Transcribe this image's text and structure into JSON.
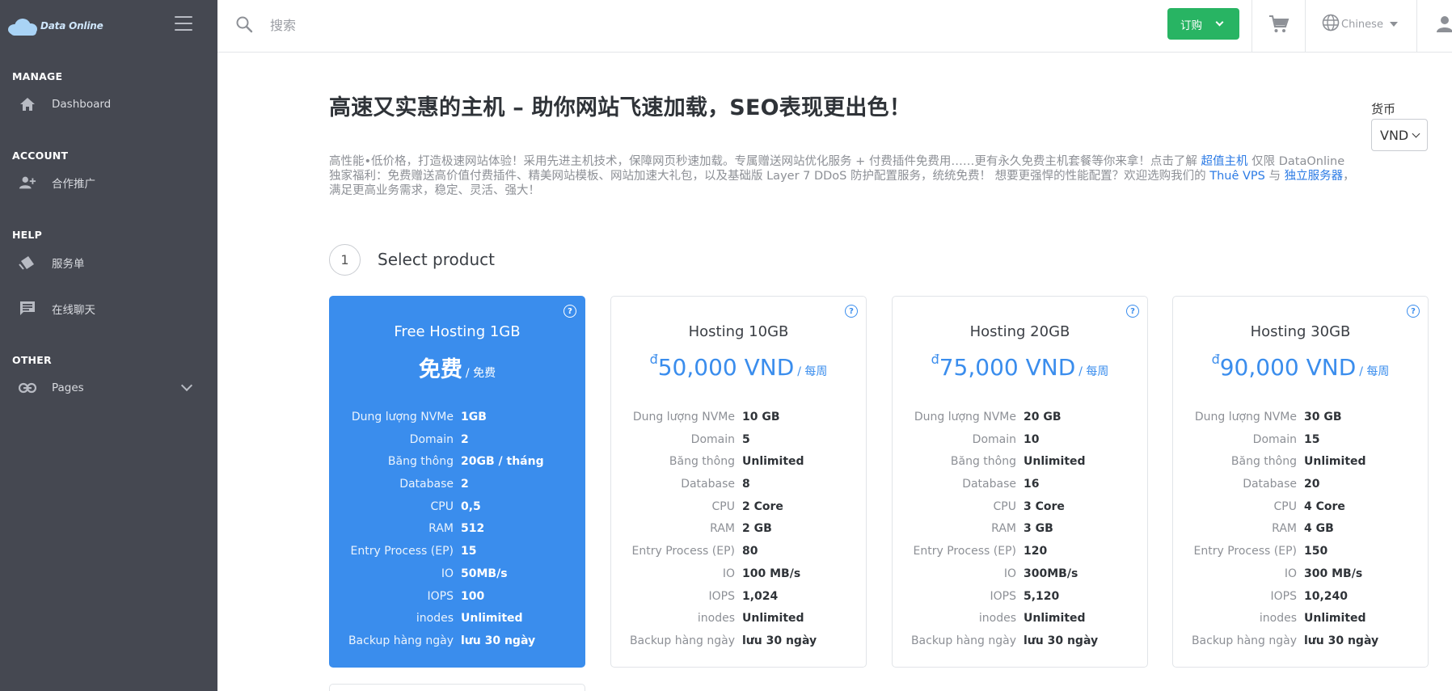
{
  "brand": {
    "name": "Data Online"
  },
  "sidebar": {
    "sections": [
      {
        "title": "MANAGE"
      },
      {
        "title": "ACCOUNT"
      },
      {
        "title": "HELP"
      },
      {
        "title": "OTHER"
      }
    ],
    "items": [
      {
        "label": "Dashboard",
        "icon": "home-icon"
      },
      {
        "label": "合作推广",
        "icon": "user-add-icon"
      },
      {
        "label": "服务单",
        "icon": "ticket-icon"
      },
      {
        "label": "在线聊天",
        "icon": "chat-icon"
      },
      {
        "label": "Pages",
        "icon": "link-icon"
      }
    ]
  },
  "topbar": {
    "search_placeholder": "搜索",
    "order_label": "订购",
    "language": "Chinese",
    "accent": "#28b463"
  },
  "main": {
    "title": "高速又实惠的主机 – 助你网站飞速加载，SEO表现更出色！",
    "currency_label": "货币",
    "currency_value": "VND",
    "intro": {
      "text1": "高性能•低价格，打造极速网站体验！采用先进主机技术，保障网页秒速加载。专属赠送网站优化服务 + 付费插件免费用……更有永久免费主机套餐等你来拿！点击了解 ",
      "link1": "超值主机",
      "text2": " 仅限 DataOnline 独家福利：免费赠送高价值付费插件、精美网站模板、网站加速大礼包，以及基础版 Layer 7 DDoS 防护配置服务，统统免费！ 想要更强悍的性能配置？欢迎选购我们的 ",
      "link2": "Thuê VPS",
      "text3": " 与 ",
      "link3": "独立服务器",
      "text4": "，满足更高业务需求，稳定、灵活、强大！"
    },
    "step_number": "1",
    "step_title": "Select product"
  },
  "spec_keys": [
    "Dung lượng NVMe",
    "Domain",
    "Băng thông",
    "Database",
    "CPU",
    "RAM",
    "Entry Process (EP)",
    "IO",
    "IOPS",
    "inodes",
    "Backup hàng ngày"
  ],
  "products": [
    {
      "name": "Free Hosting 1GB",
      "price": "免费",
      "cycle": "/ 免费",
      "selected": true,
      "specs": [
        "1GB",
        "2",
        "20GB / tháng",
        "2",
        "0,5",
        "512",
        "15",
        "50MB/s",
        "100",
        "Unlimited",
        "lưu 30 ngày"
      ]
    },
    {
      "name": "Hosting 10GB",
      "currency_symbol": "đ",
      "price": "50,000 VND",
      "cycle": "/ 每周",
      "selected": false,
      "specs": [
        "10 GB",
        "5",
        "Unlimited",
        "8",
        "2 Core",
        "2 GB",
        "80",
        "100 MB/s",
        "1,024",
        "Unlimited",
        "lưu 30 ngày"
      ]
    },
    {
      "name": "Hosting 20GB",
      "currency_symbol": "đ",
      "price": "75,000 VND",
      "cycle": "/ 每周",
      "selected": false,
      "specs": [
        "20 GB",
        "10",
        "Unlimited",
        "16",
        "3 Core",
        "3 GB",
        "120",
        "300MB/s",
        "5,120",
        "Unlimited",
        "lưu 30 ngày"
      ]
    },
    {
      "name": "Hosting 30GB",
      "currency_symbol": "đ",
      "price": "90,000 VND",
      "cycle": "/ 每周",
      "selected": false,
      "specs": [
        "30 GB",
        "15",
        "Unlimited",
        "20",
        "4 Core",
        "4 GB",
        "150",
        "300 MB/s",
        "10,240",
        "Unlimited",
        "lưu 30 ngày"
      ]
    }
  ],
  "colors": {
    "primary": "#3a8ded",
    "sidebar": "#454851"
  }
}
